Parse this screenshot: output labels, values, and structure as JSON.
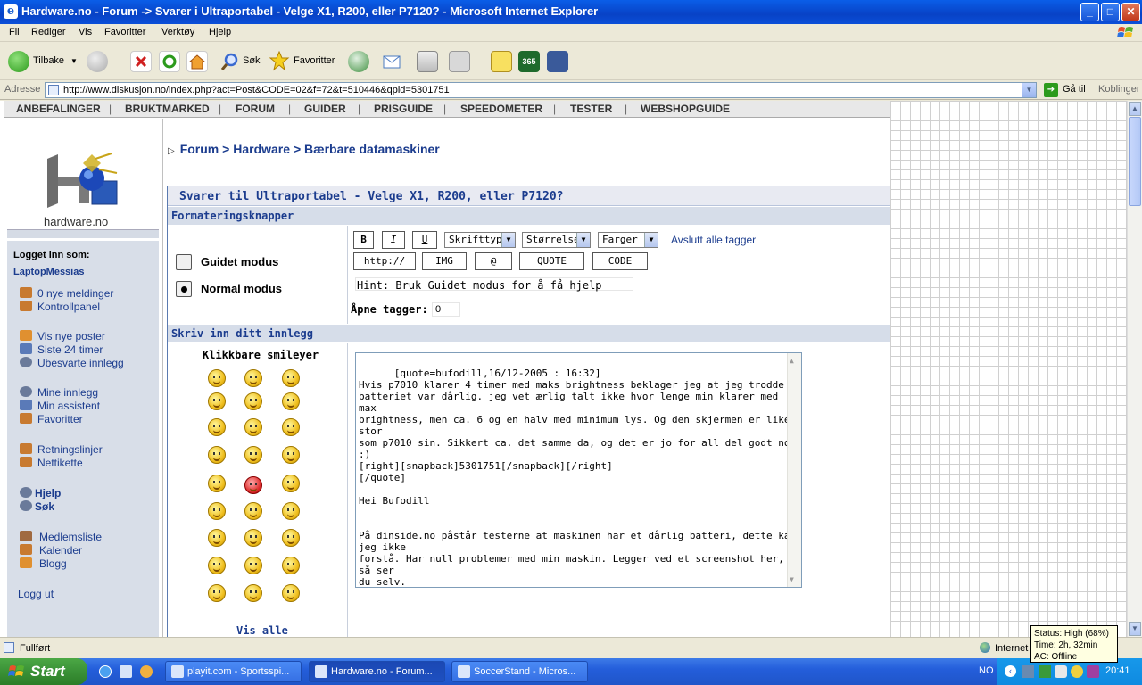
{
  "window": {
    "title": "Hardware.no - Forum -> Svarer i Ultraportabel - Velge X1, R200, eller P7120? - Microsoft Internet Explorer",
    "min": "_",
    "max": "□",
    "close": "✕"
  },
  "menu": {
    "items": [
      "Fil",
      "Rediger",
      "Vis",
      "Favoritter",
      "Verktøy",
      "Hjelp"
    ]
  },
  "toolbar": {
    "back_label": "Tilbake",
    "search_label": "Søk",
    "favorites_label": "Favoritter"
  },
  "address": {
    "label": "Adresse",
    "url": "http://www.diskusjon.no/index.php?act=Post&CODE=02&f=72&t=510446&qpid=5301751",
    "go_label": "Gå til",
    "links_label": "Koblinger"
  },
  "site": {
    "topnav": [
      "ANBEFALINGER",
      "BRUKTMARKED",
      "FORUM",
      "GUIDER",
      "PRISGUIDE",
      "SPEEDOMETER",
      "TESTER",
      "WEBSHOPGUIDE"
    ],
    "logo_text": "hardware.no",
    "breadcrumb": [
      "Forum",
      "Hardware",
      "Bærbare datamaskiner"
    ],
    "breadcrumb_sep": ">"
  },
  "sidebar": {
    "logged_in_label": "Logget inn som:",
    "username": "LaptopMessias",
    "group1": [
      "0 nye meldinger",
      "Kontrollpanel"
    ],
    "group2": [
      "Vis nye poster",
      "Siste 24 timer",
      "Ubesvarte innlegg"
    ],
    "group3": [
      "Mine innlegg",
      "Min assistent",
      "Favoritter"
    ],
    "group4": [
      "Retningslinjer",
      "Nettikette"
    ],
    "group5": [
      "Hjelp",
      "Søk"
    ],
    "group6": [
      "Medlemsliste",
      "Kalender",
      "Blogg"
    ],
    "logout": "Logg ut"
  },
  "post": {
    "heading": "Svarer til Ultraportabel - Velge X1, R200, eller P7120?",
    "format_section": "Formateringsknapper",
    "guided_mode": "Guidet modus",
    "normal_mode": "Normal modus",
    "btn_bold": "B",
    "btn_italic": "I",
    "btn_underline": "U",
    "font_select": "Skrifttype",
    "size_select": "Størrelse",
    "color_select": "Farger",
    "close_tags": "Avslutt alle tagger",
    "btn_http": "http://",
    "btn_img": "IMG",
    "btn_at": "@",
    "btn_quote": "QUOTE",
    "btn_code": "CODE",
    "hint": "Hint: Bruk Guidet modus for å få hjelp",
    "open_tags_label": "Åpne tagger:",
    "open_tags_value": "0",
    "write_section": "Skriv inn ditt innlegg",
    "smileys_title": "Klikkbare smileyer",
    "show_all": "Vis alle",
    "body": "[quote=bufodill,16/12-2005 : 16:32]\nHvis p7010 klarer 4 timer med maks brightness beklager jeg at jeg trodde\nbatteriet var dårlig. jeg vet ærlig talt ikke hvor lenge min klarer med max\nbrightness, men ca. 6 og en halv med minimum lys. Og den skjermen er like stor\nsom p7010 sin. Sikkert ca. det samme da, og det er jo for all del godt nok :)\n[right][snapback]5301751[/snapback][/right]\n[/quote]\n\nHei Bufodill\n\n\nPå dinside.no påstår testerne at maskinen har et dårlig batteri, dette kan jeg ikke\nforstå. Har null problemer med min maskin. Legger ved et screenshot her, så ser\ndu selv."
  },
  "statusbar": {
    "text": "Fullført",
    "zone": "Internet"
  },
  "taskbar": {
    "start": "Start",
    "tasks": [
      "playit.com - Sportsspi...",
      "Hardware.no - Forum...",
      "SoccerStand - Micros..."
    ],
    "lang": "NO",
    "clock": "20:41"
  },
  "tooltip": {
    "line1": "Status: High (68%)",
    "line2": "Time: 2h, 32min",
    "line3": "AC: Offline"
  }
}
